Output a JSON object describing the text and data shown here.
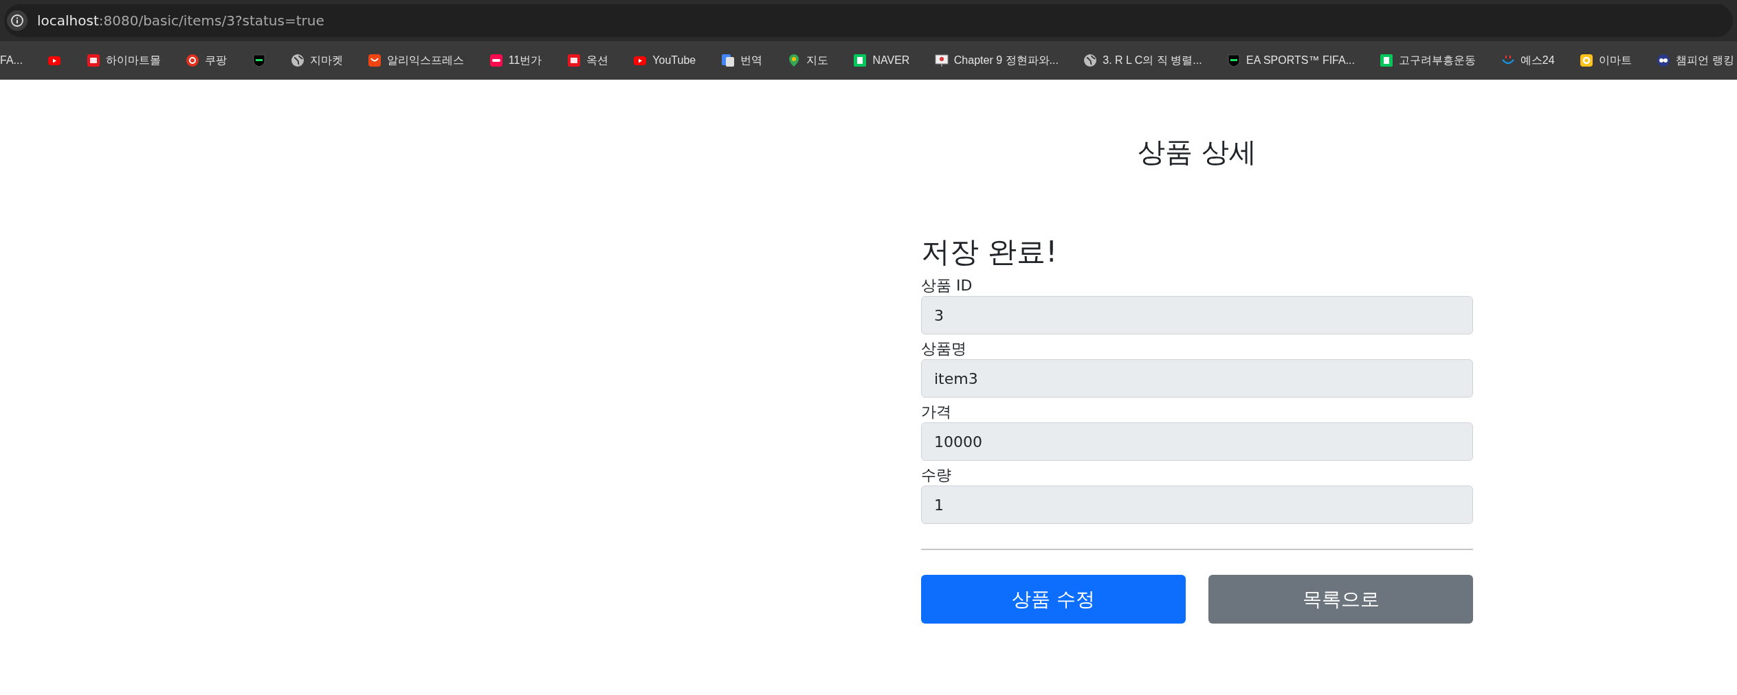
{
  "address_bar": {
    "host": "localhost",
    "path": ":8080/basic/items/3?status=true"
  },
  "bookmarks": [
    {
      "label": "FA...",
      "kind": "none"
    },
    {
      "kind": "youtube"
    },
    {
      "label": "하이마트몰",
      "kind": "redsquare"
    },
    {
      "label": "쿠팡",
      "kind": "redcircle"
    },
    {
      "kind": "shield"
    },
    {
      "label": "지마켓",
      "kind": "globe"
    },
    {
      "label": "알리익스프레스",
      "kind": "orangesquare"
    },
    {
      "label": "11번가",
      "kind": "pinksquare"
    },
    {
      "label": "옥션",
      "kind": "redsquare"
    },
    {
      "label": "YouTube",
      "kind": "youtube"
    },
    {
      "label": "번역",
      "kind": "translate"
    },
    {
      "label": "지도",
      "kind": "pin"
    },
    {
      "label": "NAVER",
      "kind": "greensquare"
    },
    {
      "label": "Chapter 9 정현파와...",
      "kind": "slides"
    },
    {
      "label": "3. R L C의 직 병렬...",
      "kind": "globe"
    },
    {
      "label": "EA SPORTS™ FIFA...",
      "kind": "shield"
    },
    {
      "label": "고구려부흥운동",
      "kind": "greensquare"
    },
    {
      "label": "예스24",
      "kind": "smile"
    },
    {
      "label": "이마트",
      "kind": "yellowsquare"
    },
    {
      "label": "챔피언 랭킹",
      "kind": "owl"
    }
  ],
  "page": {
    "title": "상품 상세",
    "message": "저장 완료!",
    "fields": [
      {
        "label": "상품 ID",
        "value": "3"
      },
      {
        "label": "상품명",
        "value": "item3"
      },
      {
        "label": "가격",
        "value": "10000"
      },
      {
        "label": "수량",
        "value": "1"
      }
    ],
    "buttons": [
      {
        "label": "상품 수정",
        "kind": "primary"
      },
      {
        "label": "목록으로",
        "kind": "secondary"
      }
    ]
  }
}
